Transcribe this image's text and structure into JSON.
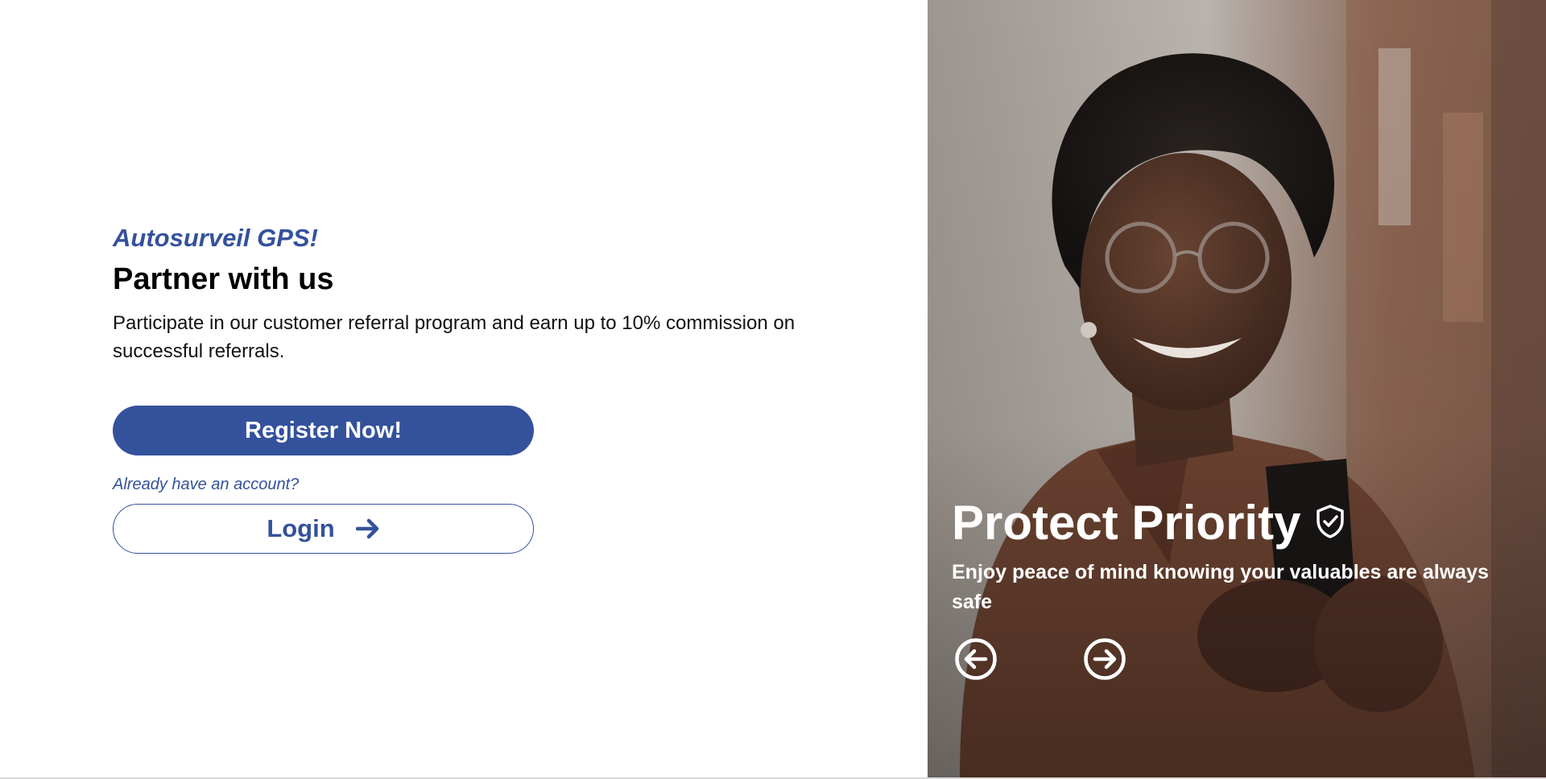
{
  "left": {
    "brand": "Autosurveil GPS!",
    "headline": "Partner with us",
    "description": "Participate in our customer referral program and earn up to 10% commission on successful referrals.",
    "register_label": "Register Now!",
    "account_prompt": "Already have an account?",
    "login_label": "Login",
    "login_icon": "arrow-right-icon"
  },
  "slide": {
    "title": "Protect Priority",
    "title_icon": "shield-check-icon",
    "subtitle": "Enjoy peace of mind knowing your valuables are always safe",
    "prev_icon": "circle-arrow-left-icon",
    "next_icon": "circle-arrow-right-icon",
    "photo": "smiling-woman-with-phone-photo"
  },
  "colors": {
    "brand_blue": "#34519c",
    "text_dark": "#000000",
    "white": "#ffffff"
  }
}
